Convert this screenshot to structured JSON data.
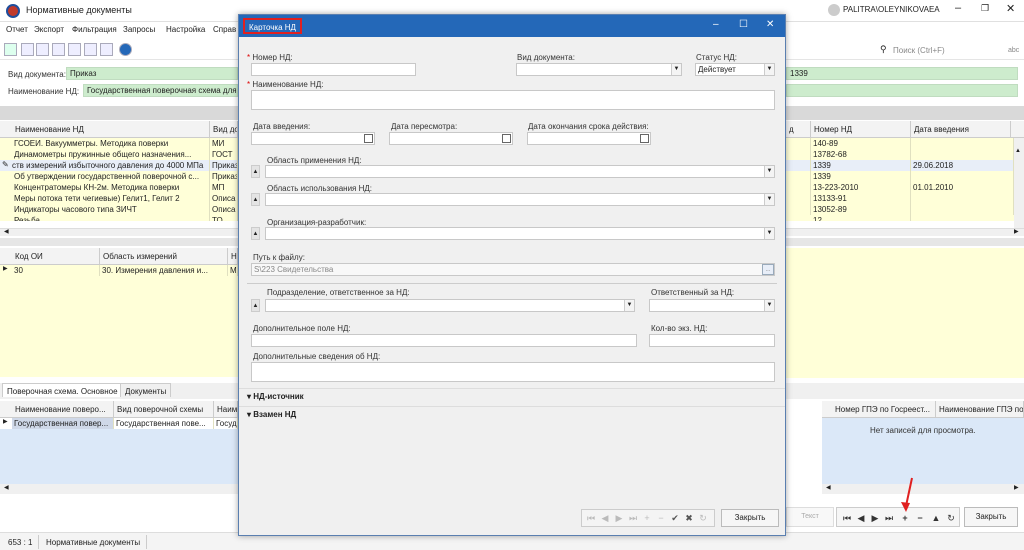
{
  "app": {
    "title": "Нормативные документы",
    "user": "PALITRA\\OLEYNIKOVAEA"
  },
  "menu": [
    "Отчет",
    "Экспорт",
    "Фильтрация",
    "Запросы",
    "Настройка",
    "Справ"
  ],
  "search_placeholder": "Поиск (Ctrl+F)",
  "search_hint": "abc",
  "filters": {
    "doc_type_label": "Вид документа:",
    "doc_type_value": "Приказ",
    "name_label": "Наименование НД:",
    "name_value": "Государственная поверочная схема для с",
    "right_value": "1339"
  },
  "main_grid": {
    "columns": [
      "Наименование НД",
      "Вид до",
      "д",
      "Номер НД",
      "Дата введения"
    ],
    "rows": [
      {
        "name": "ГСОЕИ. Вакуумметры. Методика поверки",
        "type": "МИ",
        "num": "140-89",
        "date": ""
      },
      {
        "name": "Динамометры пружинные общего назначения...",
        "type": "ГОСТ",
        "num": "13782-68",
        "date": ""
      },
      {
        "name": "ств измерений избыточного давления до 4000 МПа",
        "type": "Приказ",
        "num": "1339",
        "date": "29.06.2018"
      },
      {
        "name": "Об утверждении государственной поверочной с...",
        "type": "Приказ",
        "num": "1339",
        "date": ""
      },
      {
        "name": "Концентратомеры КН-2м. Методика поверки",
        "type": "МП",
        "num": "13-223-2010",
        "date": "01.01.2010"
      },
      {
        "name": "Меры потока тети чегиевые) Гелит1, Гелит 2",
        "type": "Описа",
        "num": "13133-91",
        "date": ""
      },
      {
        "name": "Индикаторы часового типа ЗИЧТ",
        "type": "Описа",
        "num": "13052-89",
        "date": ""
      },
      {
        "name": "Резьба",
        "type": "ТО",
        "num": "12",
        "date": ""
      }
    ]
  },
  "oi_grid": {
    "columns": [
      "Код ОИ",
      "Область измерений",
      "На"
    ],
    "rows": [
      {
        "code": "30",
        "area": "30. Измерения давления и...",
        "na": "Ма"
      }
    ]
  },
  "bottom_tabs": [
    "Поверочная схема. Основное",
    "Документы"
  ],
  "bottom_grid": {
    "columns": [
      "Наименование поверо...",
      "Вид поверочной схемы",
      "Наим"
    ],
    "rows": [
      {
        "name": "Государственная повер...",
        "kind": "Государственная пове...",
        "n": "Госуд"
      }
    ]
  },
  "right_grid": {
    "columns": [
      "Номер ГПЭ по Госреест...",
      "Наименование ГПЭ по"
    ],
    "empty_text": "Нет записей для просмотра."
  },
  "bottom_bar": {
    "text_btn": "Текст",
    "close_btn": "Закрыть"
  },
  "status": {
    "left": "653 : 1",
    "module": "Нормативные документы"
  },
  "dialog": {
    "title": "Карточка НД",
    "number_label": "Номер НД:",
    "doc_kind_label": "Вид документа:",
    "status_label": "Статус НД:",
    "status_value": "Действует",
    "name_label": "Наименование НД:",
    "intro_date_label": "Дата введения:",
    "review_date_label": "Дата пересмотра:",
    "expiry_date_label": "Дата окончания срока действия:",
    "scope_label": "Область применения НД:",
    "use_area_label": "Область использования НД:",
    "developer_label": "Организация-разработчик:",
    "file_path_label": "Путь к файлу:",
    "file_path_value": "S\\223 Свидетельства",
    "browse": "...",
    "dept_label": "Подразделение, ответственное за НД:",
    "responsible_label": "Ответственный за НД:",
    "extra_field_label": "Дополнительное поле НД:",
    "copies_label": "Кол-во экз. НД:",
    "extra_info_label": "Дополнительные сведения об НД:",
    "section_source": "НД-источник",
    "section_replaced": "Взамен НД",
    "close_btn": "Закрыть"
  }
}
